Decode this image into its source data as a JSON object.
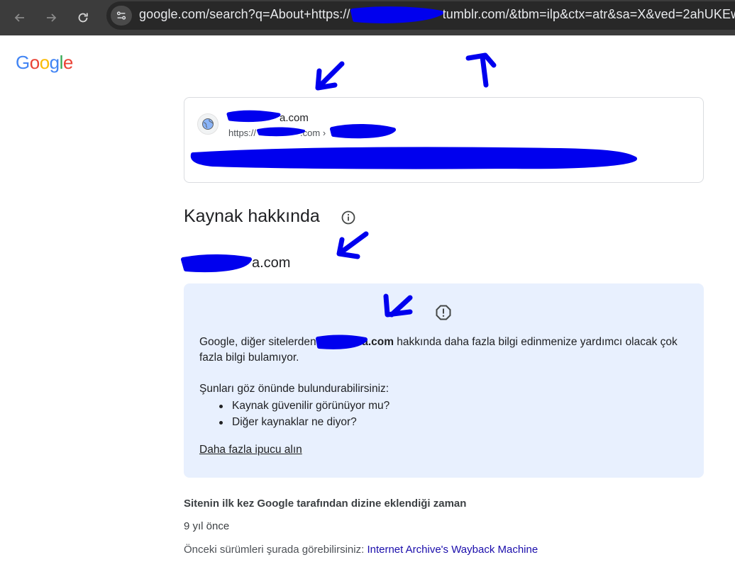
{
  "browser": {
    "url": "google.com/search?q=About+https://",
    "url_tail": "tumblr.com/&tbm=ilp&ctx=atr&sa=X&ved=2ahUKEw"
  },
  "logo": {
    "letters": [
      "G",
      "o",
      "o",
      "g",
      "l",
      "e"
    ],
    "colors": [
      "#4285F4",
      "#EA4335",
      "#FBBC05",
      "#4285F4",
      "#34A853",
      "#EA4335"
    ]
  },
  "card": {
    "site_name": "a.com",
    "site_url_prefix": "https://",
    "site_url_suffix": ".com ›"
  },
  "section": {
    "title": "Kaynak hakkında",
    "domain": "a.com"
  },
  "info_box": {
    "para_before": "Google, diğer sitelerden",
    "para_bold": "ca.com",
    "para_after": " hakkında daha fazla bilgi edinmenize yardımcı olacak çok fazla bilgi bulamıyor.",
    "consider": "Şunları göz önünde bulundurabilirsiniz:",
    "tips": [
      "Kaynak güvenilir görünüyor mu?",
      "Diğer kaynaklar ne diyor?"
    ],
    "more_link": "Daha fazla ipucu alın"
  },
  "indexed": {
    "heading": "Sitenin ilk kez Google tarafından dizine eklendiği zaman",
    "value": "9 yıl önce",
    "archive_label": "Önceki sürümleri şurada görebilirsiniz: ",
    "archive_link": "Internet Archive's Wayback Machine"
  },
  "colors": {
    "scribble": "#0000ee",
    "chrome": "#3c3c3c",
    "info_bg": "#e8f0fe",
    "link": "#1a0dab"
  }
}
